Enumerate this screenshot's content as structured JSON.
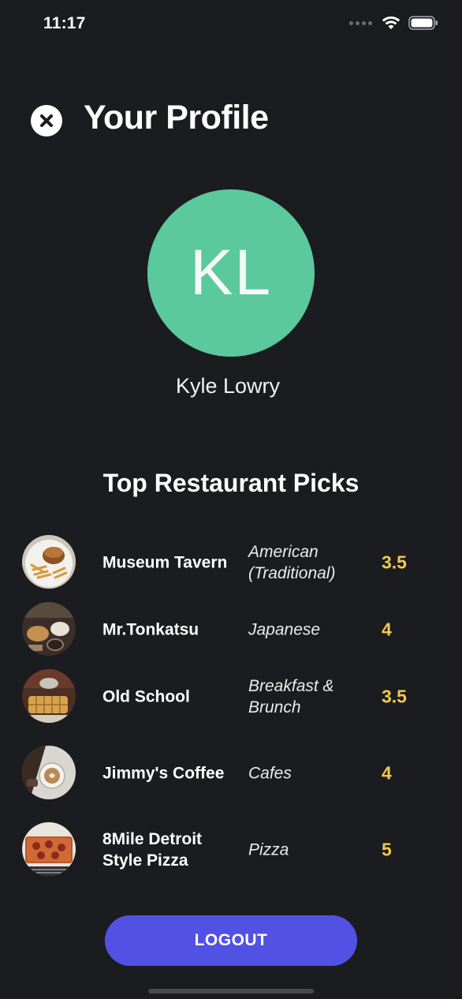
{
  "status_bar": {
    "time": "11:17",
    "icons": [
      "signal-dots-icon",
      "wifi-icon",
      "battery-icon"
    ]
  },
  "header": {
    "title": "Your Profile",
    "close_icon": "close-icon"
  },
  "profile": {
    "initials": "KL",
    "name": "Kyle Lowry",
    "avatar_color": "#5bc89d"
  },
  "section": {
    "title": "Top Restaurant Picks"
  },
  "restaurants": [
    {
      "name": "Museum Tavern",
      "cuisine": "American (Traditional)",
      "rating": "3.5",
      "image_icon": "burger-fries-photo"
    },
    {
      "name": "Mr.Tonkatsu",
      "cuisine": "Japanese",
      "rating": "4",
      "image_icon": "tonkatsu-photo"
    },
    {
      "name": "Old School",
      "cuisine": "Breakfast & Brunch",
      "rating": "3.5",
      "image_icon": "waffle-photo"
    },
    {
      "name": "Jimmy's Coffee",
      "cuisine": "Cafes",
      "rating": "4",
      "image_icon": "coffee-photo"
    },
    {
      "name": "8Mile Detroit Style Pizza",
      "cuisine": "Pizza",
      "rating": "5",
      "image_icon": "pizza-photo"
    }
  ],
  "logout": {
    "label": "LOGOUT",
    "color": "#5152e3"
  },
  "colors": {
    "background": "#1b1c1f",
    "rating": "#f2c94c"
  }
}
